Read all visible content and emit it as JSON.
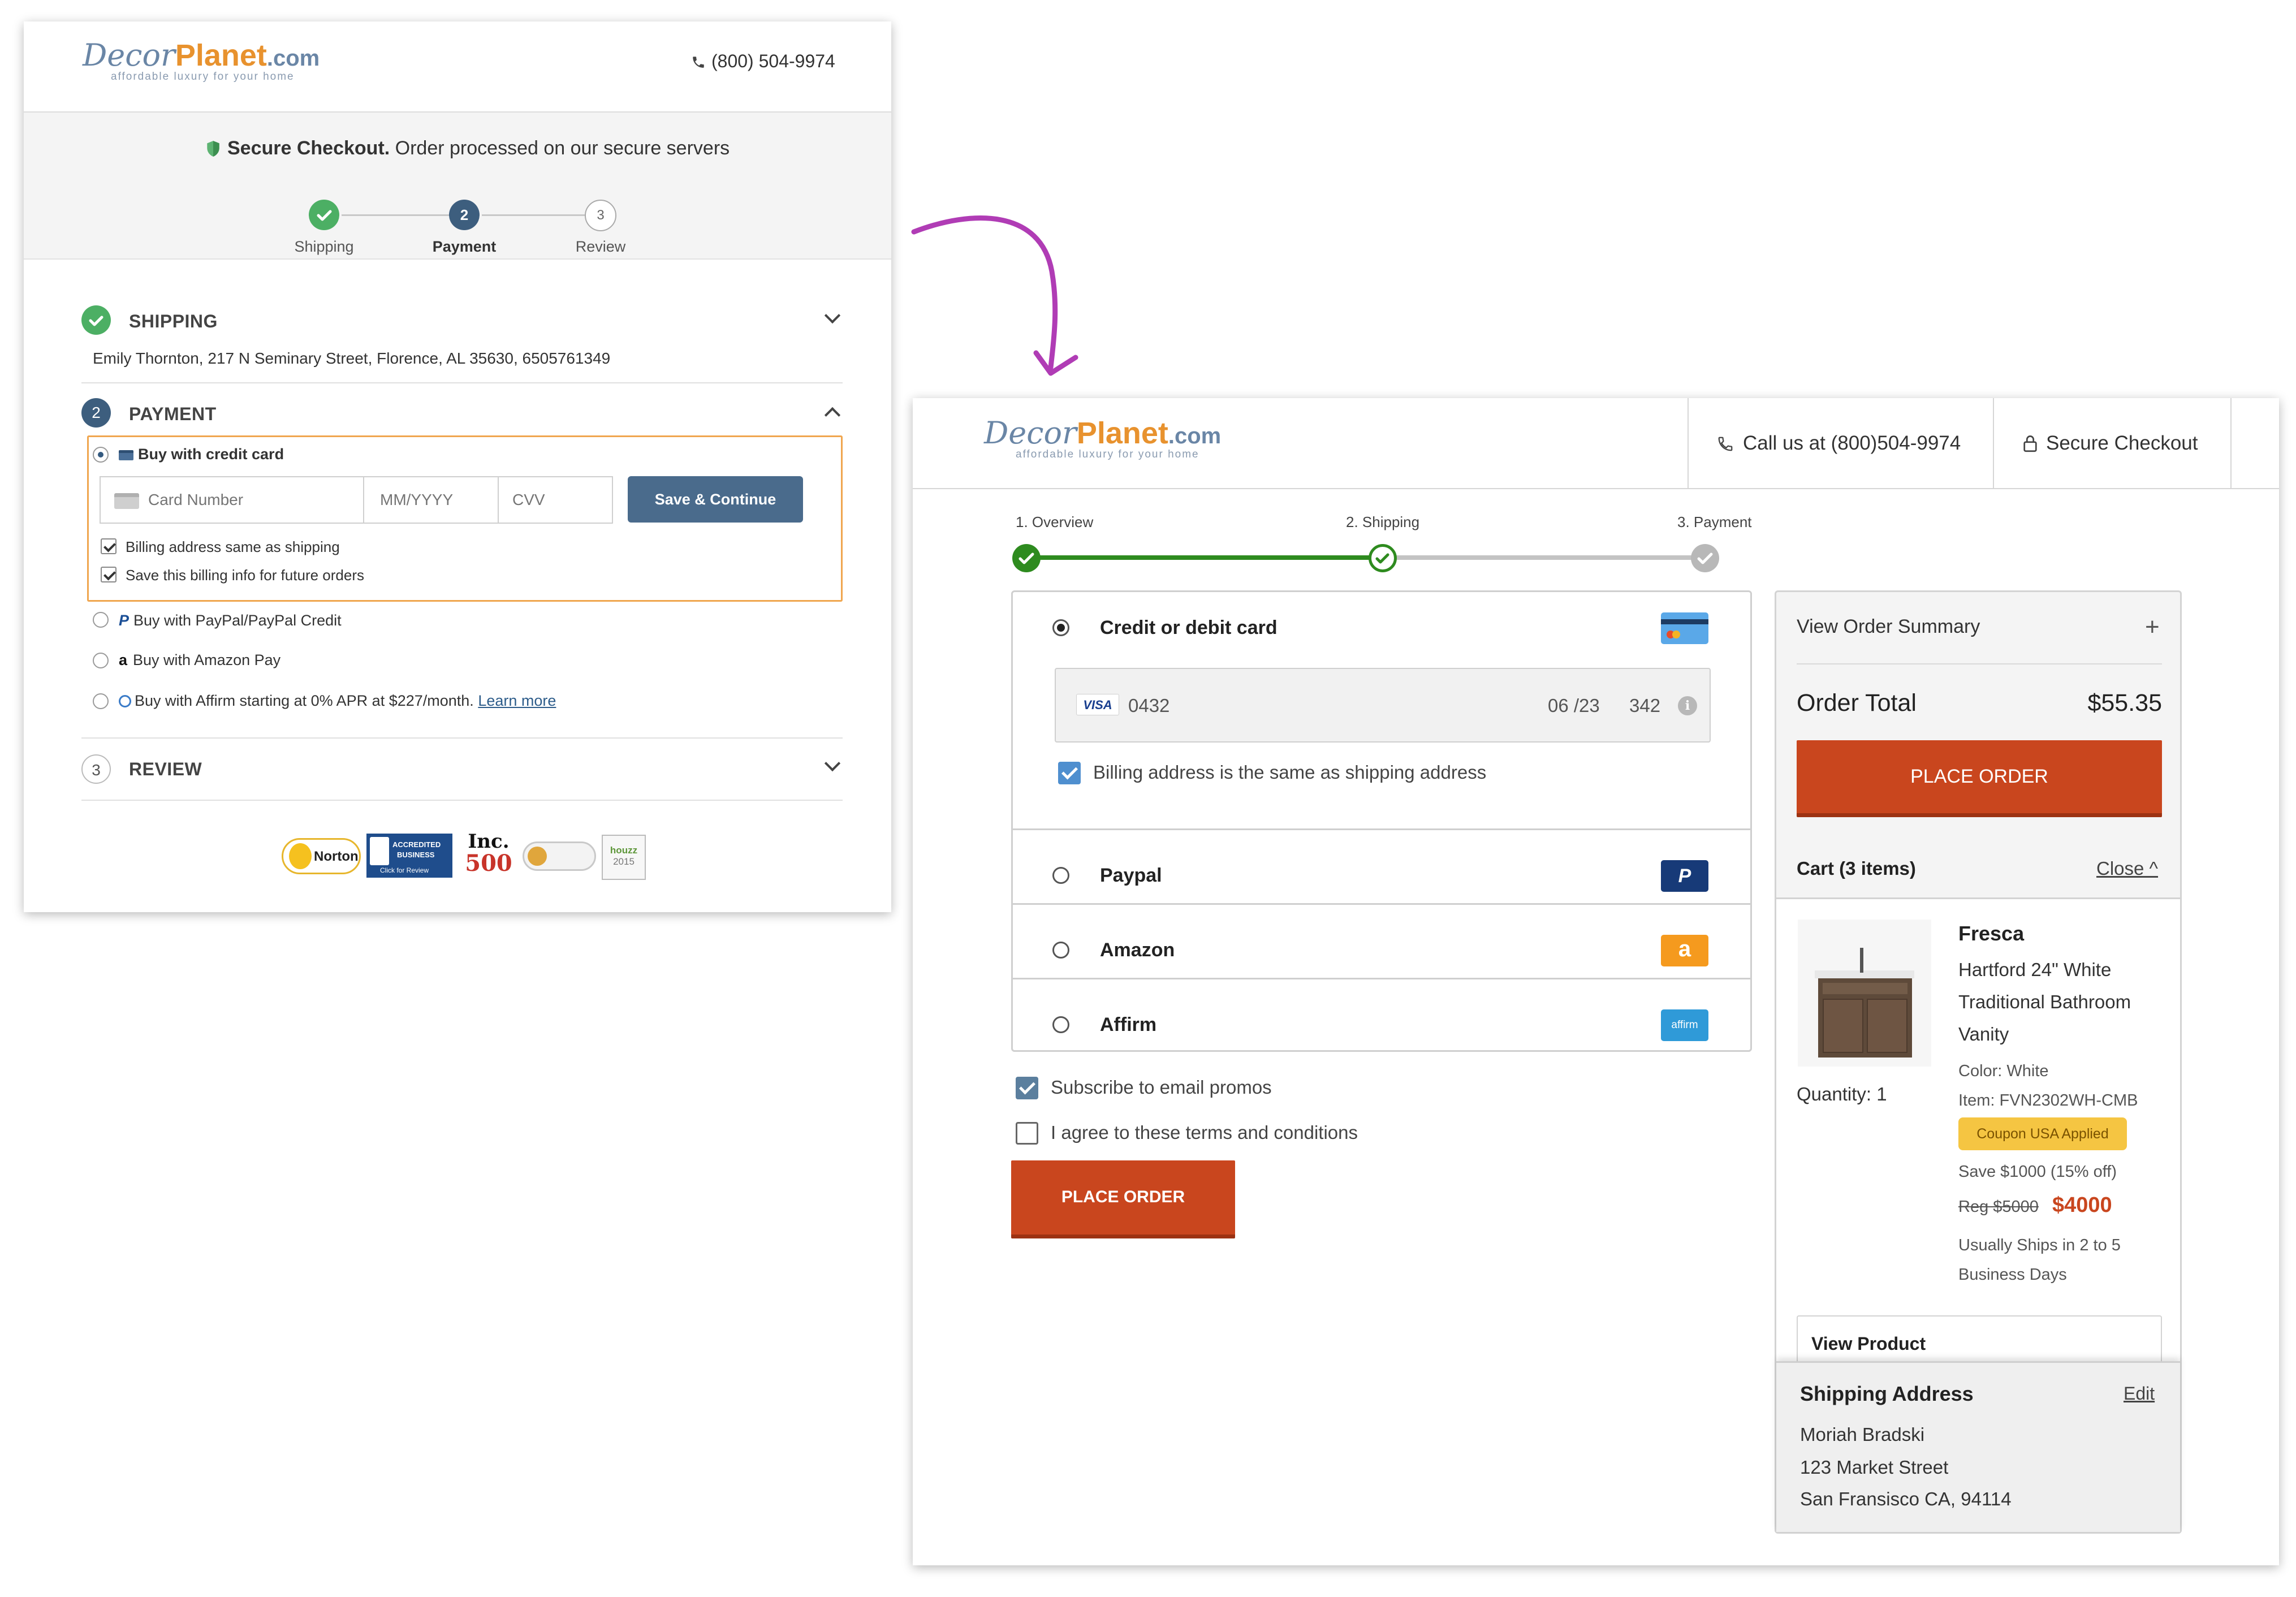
{
  "before": {
    "logo": {
      "decor": "Decor",
      "planet": "Planet",
      "com": ".com",
      "tagline": "affordable luxury for your home"
    },
    "phone": "(800) 504-9974",
    "secure": {
      "bold": "Secure Checkout.",
      "rest": " Order processed on our secure servers"
    },
    "steps": [
      {
        "label": "Shipping",
        "num": ""
      },
      {
        "label": "Payment",
        "num": "2"
      },
      {
        "label": "Review",
        "num": "3"
      }
    ],
    "shipping": {
      "num": "",
      "title": "SHIPPING",
      "address": "Emily Thornton, 217 N Seminary Street, Florence, AL 35630, 6505761349"
    },
    "payment": {
      "num": "2",
      "title": "PAYMENT",
      "credit_label": "Buy with credit card",
      "card_number_placeholder": "Card Number",
      "expiry_placeholder": "MM/YYYY",
      "cvv_placeholder": "CVV",
      "save_button": "Save & Continue",
      "billing_same": "Billing address same as shipping",
      "save_info": "Save this billing info for future orders",
      "paypal": "Buy with PayPal/PayPal Credit",
      "amazon": "Buy with Amazon Pay",
      "affirm": "Buy with Affirm starting at 0% APR at $227/month.",
      "learn_more": "Learn more"
    },
    "review": {
      "num": "3",
      "title": "REVIEW"
    },
    "badges": {
      "norton": "Norton",
      "bbb_line1": "ACCREDITED",
      "bbb_line2": "BUSINESS",
      "bbb_click": "Click for Review",
      "inc": "Inc.",
      "inc_num": "500",
      "houzz": "houzz",
      "houzz_year": "2015"
    }
  },
  "after": {
    "logo": {
      "decor": "Decor",
      "planet": "Planet",
      "com": ".com",
      "tagline": "affordable luxury for your home"
    },
    "call": "Call us at (800)504-9974",
    "secure": "Secure Checkout",
    "progress": [
      "1. Overview",
      "2. Shipping",
      "3. Payment"
    ],
    "payment_options": {
      "card": "Credit or debit card",
      "card_brand": "VISA",
      "card_last4": "0432",
      "card_exp": "06 /23",
      "card_cvv": "342",
      "billing_same": "Billing address is the same as shipping address",
      "paypal": "Paypal",
      "amazon": "Amazon",
      "affirm": "Affirm",
      "affirm_icon_text": "affirm"
    },
    "subscribe": "Subscribe to email promos",
    "terms": "I agree to these terms and conditions",
    "place_order": "PLACE ORDER",
    "summary": {
      "view_summary": "View Order Summary",
      "total_label": "Order Total",
      "total_value": "$55.35",
      "place_order": "PLACE ORDER",
      "cart_title": "Cart (3 items)",
      "close": "Close ^",
      "brand": "Fresca",
      "product_name": "Hartford 24\" White Traditional Bathroom Vanity",
      "quantity": "Quantity: 1",
      "color": "Color: White",
      "item": "Item: FVN2302WH-CMB",
      "coupon": "Coupon USA Applied",
      "save": "Save $1000 (15% off)",
      "reg_price": "Reg $5000",
      "price": "$4000",
      "ships": "Usually Ships in 2 to 5 Business Days",
      "view_product": "View Product",
      "ship_title": "Shipping Address",
      "edit": "Edit",
      "ship_name": "Moriah Bradski",
      "ship_street": "123 Market Street",
      "ship_city": "San Fransisco CA, 94114"
    }
  },
  "colors": {
    "accent_orange": "#c9461e",
    "brand_blue": "#6a86a6",
    "brand_orange": "#e8922e",
    "progress_green": "#2e8b1f",
    "step_green": "#4caf64",
    "step_navy": "#3d5e7e",
    "arrow_purple": "#b03cb5",
    "coupon_yellow": "#f5c542"
  }
}
